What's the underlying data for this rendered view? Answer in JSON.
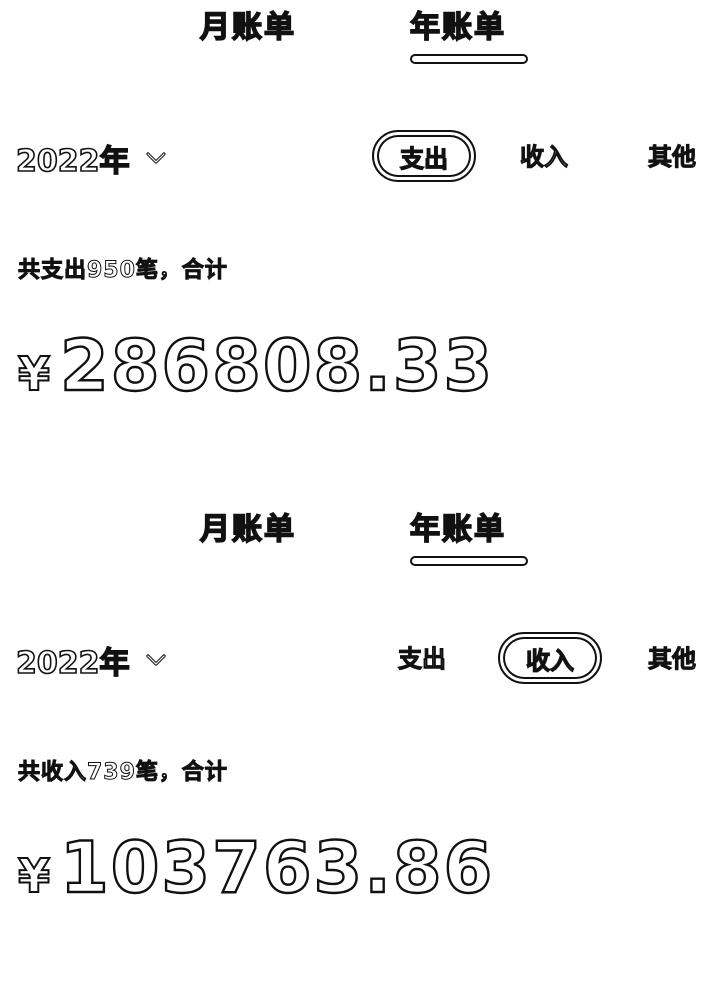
{
  "panel1": {
    "tabs": {
      "month": "月账单",
      "year": "年账单"
    },
    "year_select": {
      "label": "2022年"
    },
    "filters": {
      "expense": "支出",
      "income": "收入",
      "other": "其他"
    },
    "summary": "共支出950笔，合计",
    "amount": {
      "currency": "¥",
      "value": "286808.33"
    }
  },
  "panel2": {
    "tabs": {
      "month": "月账单",
      "year": "年账单"
    },
    "year_select": {
      "label": "2022年"
    },
    "filters": {
      "expense": "支出",
      "income": "收入",
      "other": "其他"
    },
    "summary": "共收入739笔，合计",
    "amount": {
      "currency": "¥",
      "value": "103763.86"
    }
  }
}
